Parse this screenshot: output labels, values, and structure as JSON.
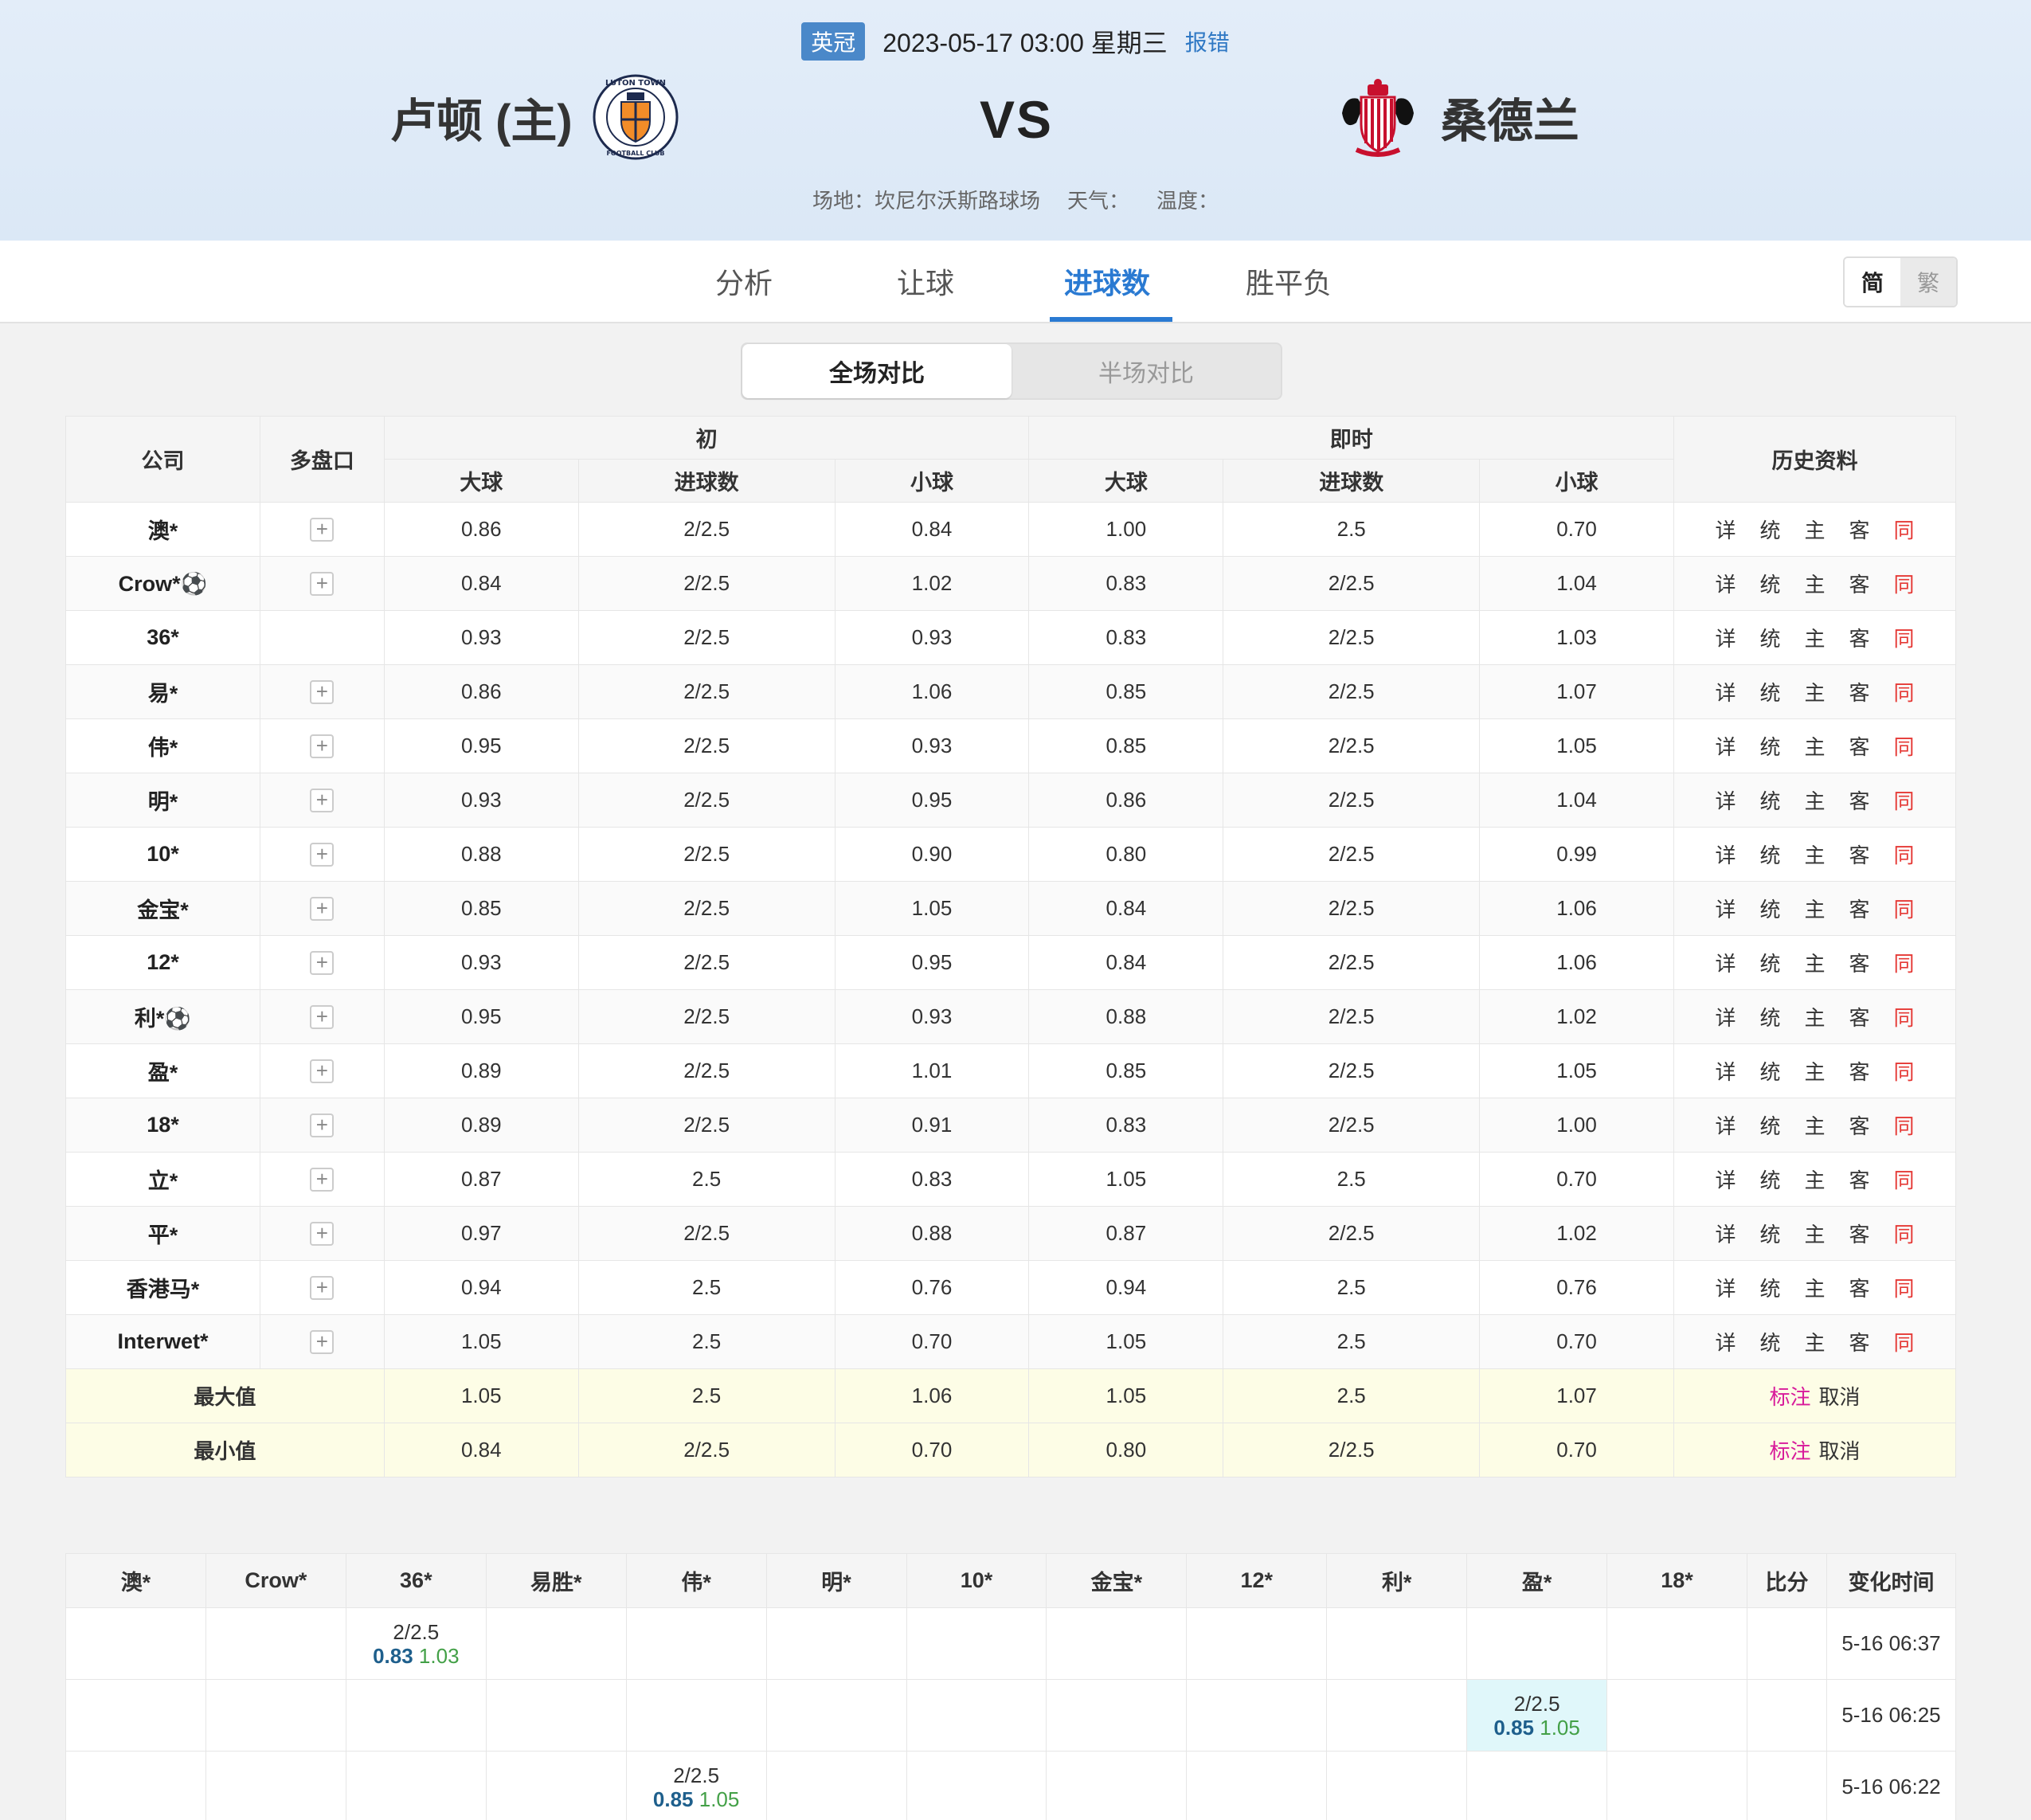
{
  "header": {
    "league": "英冠",
    "datetime": "2023-05-17 03:00 星期三",
    "report": "报错",
    "home": "卢顿 (主)",
    "away": "桑德兰",
    "vs": "VS",
    "venue": "场地：坎尼尔沃斯路球场",
    "weather": "天气：",
    "temperature": "温度："
  },
  "tabs": [
    "分析",
    "让球",
    "进球数",
    "胜平负"
  ],
  "lang": {
    "simplified": "简",
    "traditional": "繁"
  },
  "segment": {
    "full": "全场对比",
    "half": "半场对比"
  },
  "odds_table": {
    "headers": {
      "company": "公司",
      "multi": "多盘口",
      "initial": "初",
      "live": "即时",
      "history": "历史资料",
      "over": "大球",
      "line": "进球数",
      "under": "小球"
    },
    "history_links": [
      "详",
      "统",
      "主",
      "客",
      "同"
    ],
    "rows": [
      {
        "company": "澳*",
        "plus": true,
        "i_over": "0.86",
        "i_line": "2/2.5",
        "i_under": "0.84",
        "l_over": "1.00",
        "l_line": "2.5",
        "l_under": "0.70"
      },
      {
        "company": "Crow*⚽",
        "plus": true,
        "i_over": "0.84",
        "i_line": "2/2.5",
        "i_under": "1.02",
        "l_over": "0.83",
        "l_line": "2/2.5",
        "l_under": "1.04"
      },
      {
        "company": "36*",
        "plus": false,
        "i_over": "0.93",
        "i_line": "2/2.5",
        "i_under": "0.93",
        "l_over": "0.83",
        "l_line": "2/2.5",
        "l_under": "1.03"
      },
      {
        "company": "易*",
        "plus": true,
        "i_over": "0.86",
        "i_line": "2/2.5",
        "i_under": "1.06",
        "l_over": "0.85",
        "l_line": "2/2.5",
        "l_under": "1.07"
      },
      {
        "company": "伟*",
        "plus": true,
        "i_over": "0.95",
        "i_line": "2/2.5",
        "i_under": "0.93",
        "l_over": "0.85",
        "l_line": "2/2.5",
        "l_under": "1.05"
      },
      {
        "company": "明*",
        "plus": true,
        "i_over": "0.93",
        "i_line": "2/2.5",
        "i_under": "0.95",
        "l_over": "0.86",
        "l_line": "2/2.5",
        "l_under": "1.04"
      },
      {
        "company": "10*",
        "plus": true,
        "i_over": "0.88",
        "i_line": "2/2.5",
        "i_under": "0.90",
        "l_over": "0.80",
        "l_line": "2/2.5",
        "l_under": "0.99"
      },
      {
        "company": "金宝*",
        "plus": true,
        "i_over": "0.85",
        "i_line": "2/2.5",
        "i_under": "1.05",
        "l_over": "0.84",
        "l_line": "2/2.5",
        "l_under": "1.06"
      },
      {
        "company": "12*",
        "plus": true,
        "i_over": "0.93",
        "i_line": "2/2.5",
        "i_under": "0.95",
        "l_over": "0.84",
        "l_line": "2/2.5",
        "l_under": "1.06"
      },
      {
        "company": "利*⚽",
        "plus": true,
        "i_over": "0.95",
        "i_line": "2/2.5",
        "i_under": "0.93",
        "l_over": "0.88",
        "l_line": "2/2.5",
        "l_under": "1.02"
      },
      {
        "company": "盈*",
        "plus": true,
        "i_over": "0.89",
        "i_line": "2/2.5",
        "i_under": "1.01",
        "l_over": "0.85",
        "l_line": "2/2.5",
        "l_under": "1.05"
      },
      {
        "company": "18*",
        "plus": true,
        "i_over": "0.89",
        "i_line": "2/2.5",
        "i_under": "0.91",
        "l_over": "0.83",
        "l_line": "2/2.5",
        "l_under": "1.00"
      },
      {
        "company": "立*",
        "plus": true,
        "i_over": "0.87",
        "i_line": "2.5",
        "i_under": "0.83",
        "l_over": "1.05",
        "l_line": "2.5",
        "l_under": "0.70"
      },
      {
        "company": "平*",
        "plus": true,
        "i_over": "0.97",
        "i_line": "2/2.5",
        "i_under": "0.88",
        "l_over": "0.87",
        "l_line": "2/2.5",
        "l_under": "1.02"
      },
      {
        "company": "香港马*",
        "plus": true,
        "i_over": "0.94",
        "i_line": "2.5",
        "i_under": "0.76",
        "l_over": "0.94",
        "l_line": "2.5",
        "l_under": "0.76"
      },
      {
        "company": "Interwet*",
        "plus": true,
        "i_over": "1.05",
        "i_line": "2.5",
        "i_under": "0.70",
        "l_over": "1.05",
        "l_line": "2.5",
        "l_under": "0.70"
      }
    ],
    "summary": [
      {
        "label": "最大值",
        "i_over": "1.05",
        "i_line": "2.5",
        "i_under": "1.06",
        "l_over": "1.05",
        "l_line": "2.5",
        "l_under": "1.07",
        "mark": "标注",
        "cancel": "取消"
      },
      {
        "label": "最小值",
        "i_over": "0.84",
        "i_line": "2/2.5",
        "i_under": "0.70",
        "l_over": "0.80",
        "l_line": "2/2.5",
        "l_under": "0.70",
        "mark": "标注",
        "cancel": "取消"
      }
    ]
  },
  "changes_table": {
    "headers": [
      "澳*",
      "Crow*",
      "36*",
      "易胜*",
      "伟*",
      "明*",
      "10*",
      "金宝*",
      "12*",
      "利*",
      "盈*",
      "18*",
      "比分",
      "变化时间"
    ],
    "rows": [
      {
        "col": 2,
        "line": "2/2.5",
        "over": "0.83",
        "under": "1.03",
        "time": "5-16 06:37",
        "highlight": false
      },
      {
        "col": 10,
        "line": "2/2.5",
        "over": "0.85",
        "under": "1.05",
        "time": "5-16 06:25",
        "highlight": true
      },
      {
        "col": 4,
        "line": "2/2.5",
        "over": "0.85",
        "under": "1.05",
        "time": "5-16 06:22",
        "highlight": false
      }
    ]
  },
  "colors": {
    "accent": "#2a7ad2",
    "league_badge": "#4a88c9",
    "history_red": "#e53935",
    "mark_pink": "#d81b9a",
    "over_blue": "#1e5f8c",
    "under_green": "#43a047",
    "highlight": "#e0f7fa",
    "summary_bg": "#fdfde6"
  },
  "icons": {
    "home_logo": "luton-town-crest-icon",
    "away_logo": "sunderland-crest-icon",
    "plus": "plus-icon"
  }
}
